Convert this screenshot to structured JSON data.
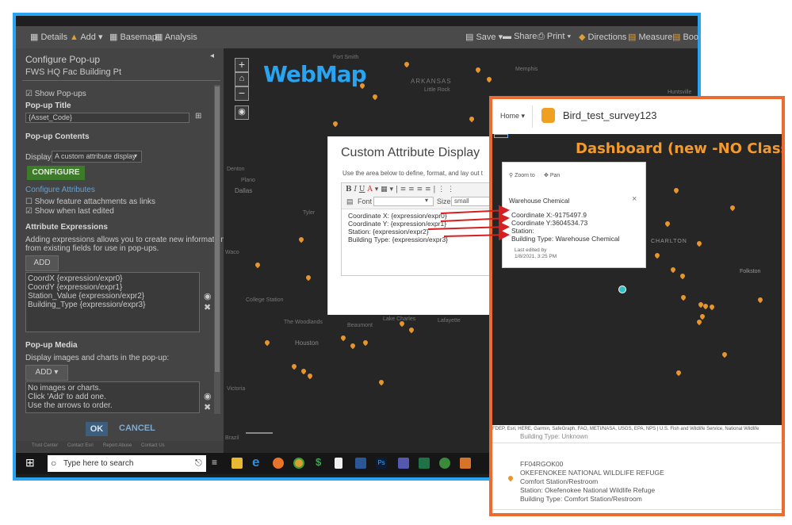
{
  "toolbar": {
    "details": "Details",
    "add": "Add",
    "basemap": "Basemap",
    "analysis": "Analysis",
    "save": "Save",
    "share": "Share",
    "print": "Print",
    "directions": "Directions",
    "measure": "Measure",
    "bookmarks": "Boo"
  },
  "panel": {
    "heading": "Configure Pop-up",
    "layer_name": "FWS HQ Fac Building Pt",
    "show_popups": "Show Pop-ups",
    "popup_title_label": "Pop-up Title",
    "popup_title_value": "{Asset_Code}",
    "popup_contents_label": "Pop-up Contents",
    "display_label": "Display:",
    "display_value": "A custom attribute display",
    "configure_button": "CONFIGURE",
    "configure_attributes": "Configure Attributes",
    "show_attachments": "Show feature attachments as links",
    "show_last_edited": "Show when last edited",
    "attribute_expressions_label": "Attribute Expressions",
    "attribute_expressions_desc_1": "Adding expressions allows you to create new information",
    "attribute_expressions_desc_2": "from existing fields for use in pop-ups.",
    "add_button": "ADD",
    "expressions": [
      "CoordX {expression/expr0}",
      "CoordY {expression/expr1}",
      "Station_Value {expression/expr2}",
      "Building_Type {expression/expr3}"
    ],
    "media_label": "Pop-up Media",
    "media_desc": "Display images and charts in the pop-up:",
    "media_add_button": "ADD",
    "media_list": [
      "No images or charts.",
      "Click 'Add' to add one.",
      "Use the arrows to order."
    ],
    "ok_button": "OK",
    "cancel_button": "CANCEL",
    "footer_links": [
      "Trust Center",
      "Contact Esri",
      "Report Abuse",
      "Contact Us"
    ]
  },
  "map": {
    "label": "WebMap",
    "cities": [
      "Fort Smith",
      "Memphis",
      "ARKANSAS",
      "Little Rock",
      "Huntsville",
      "Denton",
      "Plano",
      "Dallas",
      "Tyler",
      "Waco",
      "College Station",
      "The Woodlands",
      "Houston",
      "Beaumont",
      "Lake Charles",
      "Lafayette",
      "Victoria",
      "Brazil"
    ]
  },
  "dialog": {
    "title": "Custom Attribute Display",
    "description": "Use the area below to define, format, and lay out t",
    "font_label": "Font",
    "size_label": "Size",
    "size_value": "small",
    "lines": [
      "Coordinate X: {expression/expr0}",
      "Coordinate Y: {expression/expr1}",
      "Station: {expression/expr2}",
      "Building Type: {expression/expr3}"
    ]
  },
  "taskbar": {
    "search_placeholder": "Type here to search"
  },
  "dashboard": {
    "home_label": "Home",
    "app_title": "Bird_test_survey123",
    "overlay_label": "Dashboard (new -NO Classic)",
    "popup": {
      "zoom_to": "Zoom to",
      "pan": "Pan",
      "feature_title": "Warehouse Chemical",
      "lines": [
        "Coordinate X:-9175497.9",
        "Coordinate Y:3604534.73",
        "Station:",
        "Building Type: Warehouse Chemical"
      ],
      "last_edited_1": "Last edited by",
      "last_edited_2": "1/8/2021, 3:25 PM"
    },
    "map_cities": [
      "CHARLTON",
      "Folkston"
    ],
    "attribution": "FDEP, Esri, HERE, Garmin, SafeGraph, FAO, METI/NASA, USGS, EPA, NPS | U.S. Fish and Wildlife Service, National Wildlife",
    "partial_line": "Building Type: Unknown",
    "list_item": {
      "code": "FF04RGOK00",
      "name": "OKEFENOKEE NATIONAL WILDLIFE REFUGE",
      "type": "Comfort Station/Restroom",
      "station": "Station: Okefenokee National Wildlife Refuge",
      "building": "Building Type: Comfort Station/Restroom"
    }
  },
  "colors": {
    "blue_frame": "#2aa3f0",
    "orange_frame": "#ee6a2e",
    "arrow_red": "#d42020",
    "pin_orange": "#e8952a",
    "configure_green": "#3d7a2a"
  }
}
